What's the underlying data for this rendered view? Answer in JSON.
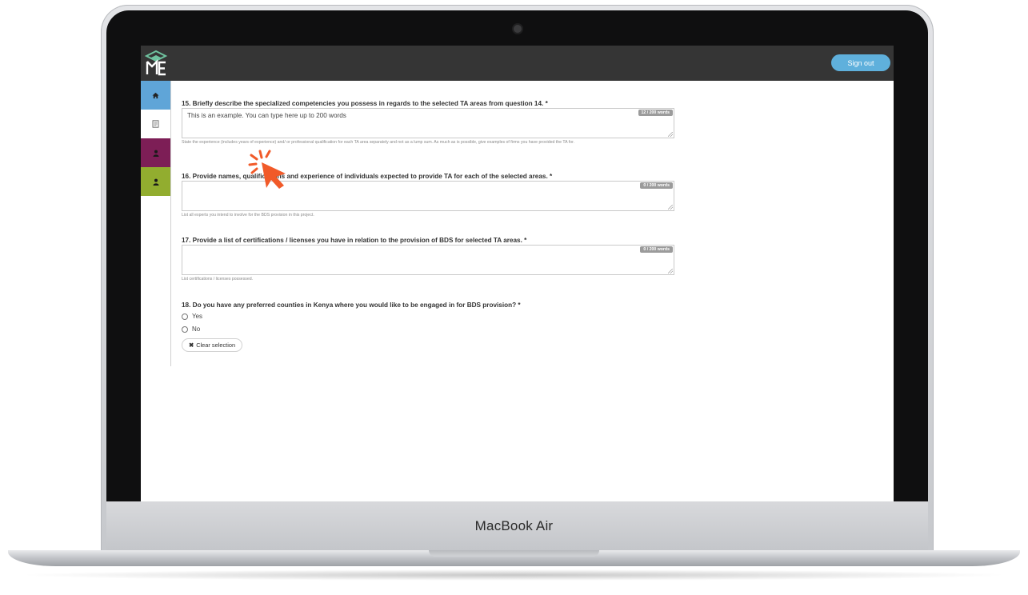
{
  "device": {
    "brand_label": "MacBook Air"
  },
  "header": {
    "signout_label": "Sign out"
  },
  "sidebar": {
    "items": [
      {
        "name": "home",
        "icon": "home-icon",
        "color": "#5fa5d8"
      },
      {
        "name": "documents",
        "icon": "document-icon",
        "color": "#ffffff"
      },
      {
        "name": "profile",
        "icon": "user-icon",
        "color": "#7d1e56"
      },
      {
        "name": "account",
        "icon": "user-icon",
        "color": "#92ad2f"
      }
    ]
  },
  "form": {
    "q15": {
      "label": "15. Briefly describe the specialized competencies you possess in regards to the selected TA areas from question 14. *",
      "value": "This is an example. You can type here up to 200 words",
      "word_count": "12 / 200 words",
      "help": "State the experience (includes years of experience) and/ or professional qualification for each TA area separately and not as a lump sum. As much as is possible, give examples of firms you have provided the TA for."
    },
    "q16": {
      "label": "16. Provide names, qualifications and experience of individuals expected to provide TA for each of the selected areas. *",
      "value": "",
      "word_count": "0 / 200 words",
      "help": "List all experts you intend to involve for the BDS provision in this project."
    },
    "q17": {
      "label": "17. Provide a list of certifications / licenses you have in relation to the provision of BDS for selected TA areas. *",
      "value": "",
      "word_count": "0 / 200 words",
      "help": "List certifications / licenses possessed."
    },
    "q18": {
      "label": "18. Do you have any preferred counties in Kenya where you would like to be engaged in for BDS provision? *",
      "options": [
        "Yes",
        "No"
      ],
      "clear_label": "Clear selection"
    }
  },
  "colors": {
    "topbar": "#353535",
    "accent": "#5fb0dc",
    "pointer": "#f15a29"
  }
}
